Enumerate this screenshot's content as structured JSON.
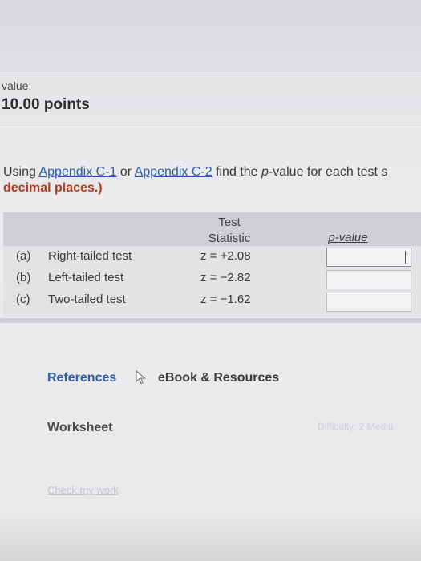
{
  "header": {
    "value_label": "value:",
    "points": "10.00 points"
  },
  "question": {
    "prefix": "Using ",
    "link1": "Appendix C-1",
    "or": " or ",
    "link2": "Appendix C-2",
    "suffix_a": " find the ",
    "p_italic": "p",
    "suffix_b": "-value for each test s",
    "line2": "decimal places.)"
  },
  "table": {
    "stat_header_1": "Test",
    "stat_header_2": "Statistic",
    "pvalue_header": "p-value",
    "rows": [
      {
        "part": "(a)",
        "test": "Right-tailed test",
        "stat": "z = +2.08"
      },
      {
        "part": "(b)",
        "test": "Left-tailed test",
        "stat": "z = −2.82"
      },
      {
        "part": "(c)",
        "test": "Two-tailed test",
        "stat": "z = −1.62"
      }
    ]
  },
  "footer": {
    "references": "References",
    "ebook": "eBook & Resources",
    "worksheet": "Worksheet",
    "difficulty": "Difficulty: 2 Mediu",
    "check_work": "Check my work"
  },
  "colors": {
    "link": "#2a5db0",
    "instruction": "#b03a1e"
  }
}
